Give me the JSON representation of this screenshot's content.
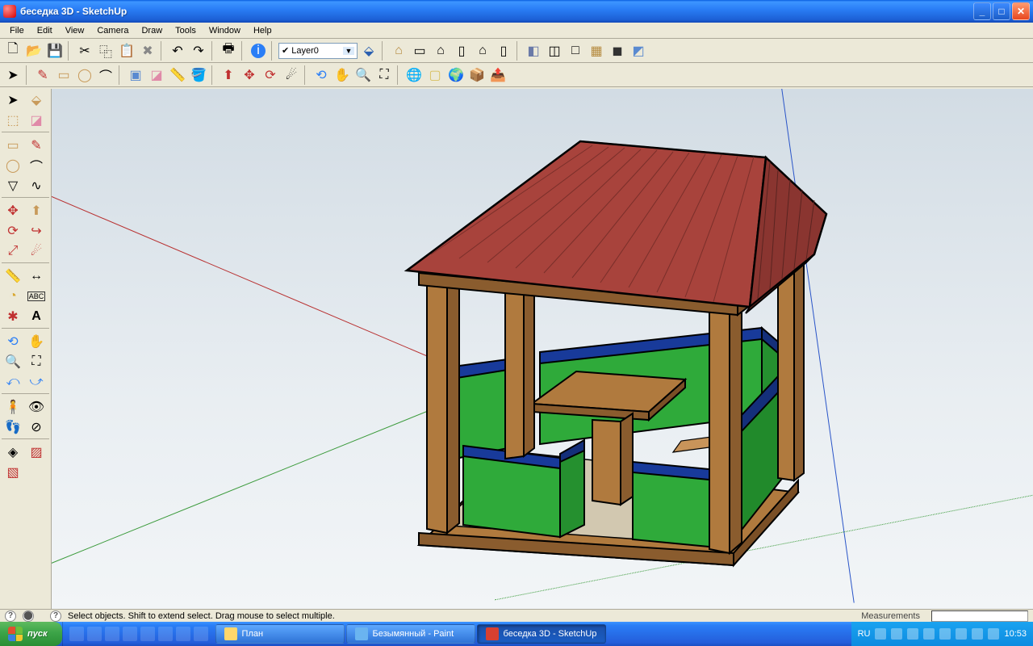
{
  "window": {
    "title": "беседка 3D - SketchUp"
  },
  "menu": {
    "file": "File",
    "edit": "Edit",
    "view": "View",
    "camera": "Camera",
    "draw": "Draw",
    "tools": "Tools",
    "window": "Window",
    "help": "Help"
  },
  "layer": {
    "selected": "Layer0"
  },
  "status": {
    "hint": "Select objects. Shift to extend select. Drag mouse to select multiple.",
    "measurements_label": "Measurements"
  },
  "taskbar": {
    "start": "пуск",
    "items": [
      {
        "label": "План"
      },
      {
        "label": "Безымянный - Paint"
      },
      {
        "label": "беседка 3D - SketchUp"
      }
    ],
    "lang": "RU",
    "clock": "10:53"
  }
}
